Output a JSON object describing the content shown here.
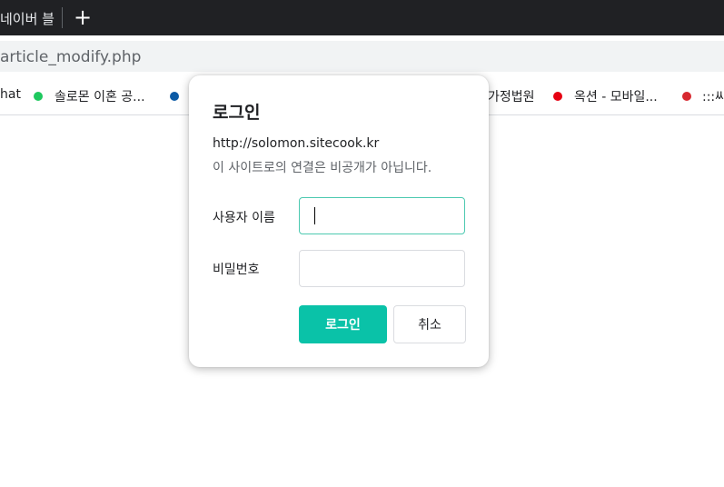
{
  "tab": {
    "title_visible": "네이버 블",
    "title_faded": "",
    "new_tab_symbol": "+"
  },
  "address_bar": {
    "url": "article_modify.php"
  },
  "bookmarks": [
    {
      "label": "hat",
      "color": ""
    },
    {
      "label": "솔로몬 이혼 공...",
      "color": "#1ec85e"
    },
    {
      "label": "",
      "color": "#0b5aa5"
    },
    {
      "label": "가정법원",
      "color": ""
    },
    {
      "label": "옥션 - 모바일...",
      "color": "#e60012"
    },
    {
      "label": ":::씨",
      "color": "#d7282f"
    }
  ],
  "dialog": {
    "title": "로그인",
    "origin": "http://solomon.sitecook.kr",
    "note": "이 사이트로의 연결은 비공개가 아닙니다.",
    "username_label": "사용자 이름",
    "username_value": "",
    "password_label": "비밀번호",
    "password_value": "",
    "login_button": "로그인",
    "cancel_button": "취소",
    "accent_color": "#0ac2a8"
  }
}
